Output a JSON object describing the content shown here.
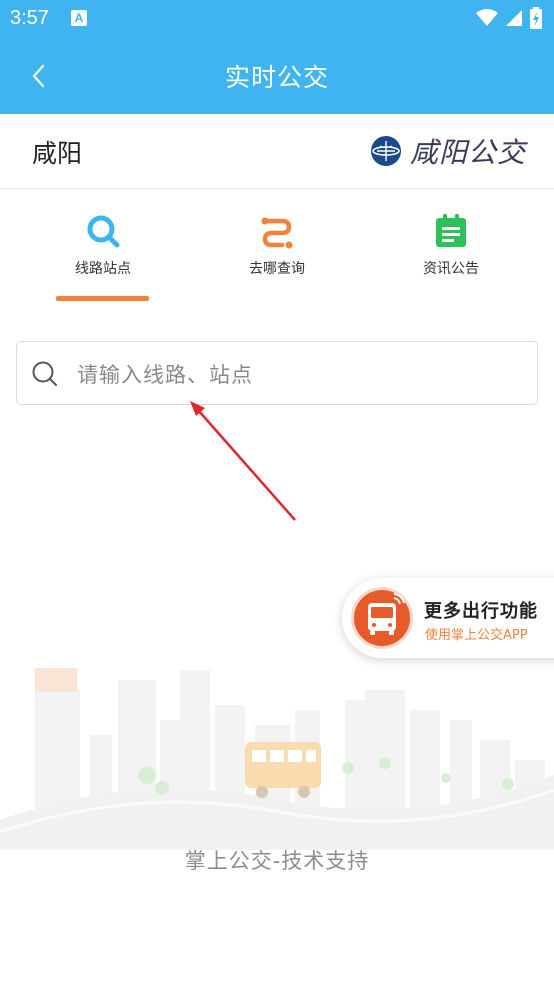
{
  "status_bar": {
    "time": "3:57",
    "notification_icon": "A"
  },
  "app_bar": {
    "title": "实时公交",
    "back_icon": "chevron-left"
  },
  "city_row": {
    "city": "咸阳",
    "brand_name": "咸阳公交"
  },
  "tabs": [
    {
      "label": "线路站点",
      "icon": "search-icon",
      "active": true
    },
    {
      "label": "去哪查询",
      "icon": "route-icon",
      "active": false
    },
    {
      "label": "资讯公告",
      "icon": "notice-icon",
      "active": false
    }
  ],
  "search": {
    "placeholder": "请输入线路、站点",
    "value": ""
  },
  "promo": {
    "title": "更多出行功能",
    "subtitle": "使用掌上公交APP"
  },
  "footer": {
    "text": "掌上公交-技术支持"
  },
  "colors": {
    "primary": "#3fb4f0",
    "accent": "#f0823a",
    "annotation_arrow": "#e0262a"
  }
}
